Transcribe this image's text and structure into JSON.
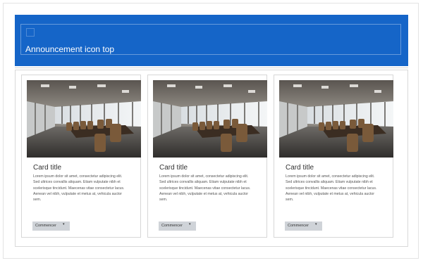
{
  "banner": {
    "title": "Announcement icon top"
  },
  "cards": [
    {
      "title": "Card title",
      "text": "Lorem ipsum dolor sit amet, consectetur adipiscing elit. Sed ultrices convallis aliquam. Etiam vulputate nibh et scelerisque tincidunt. Maecenas vitae consectetur lacus. Aenean vel nibh, vulputate et metus at, vehicula auctor sem.",
      "button_label": "Commencer",
      "button_caret": "▾"
    },
    {
      "title": "Card title",
      "text": "Lorem ipsum dolor sit amet, consectetur adipiscing elit. Sed ultrices convallis aliquam. Etiam vulputate nibh et scelerisque tincidunt. Maecenas vitae consectetur lacus. Aenean vel nibh, vulputate et metus at, vehicula auctor sem.",
      "button_label": "Commencer",
      "button_caret": "▾"
    },
    {
      "title": "Card title",
      "text": "Lorem ipsum dolor sit amet, consectetur adipiscing elit. Sed ultrices convallis aliquam. Etiam vulputate nibh et scelerisque tincidunt. Maecenas vitae consectetur lacus. Aenean vel nibh, vulputate et metus at, vehicula auctor sem.",
      "button_label": "Commencer",
      "button_caret": "▾"
    }
  ],
  "colors": {
    "banner": "#1565c8",
    "button": "#cfd3d8"
  }
}
